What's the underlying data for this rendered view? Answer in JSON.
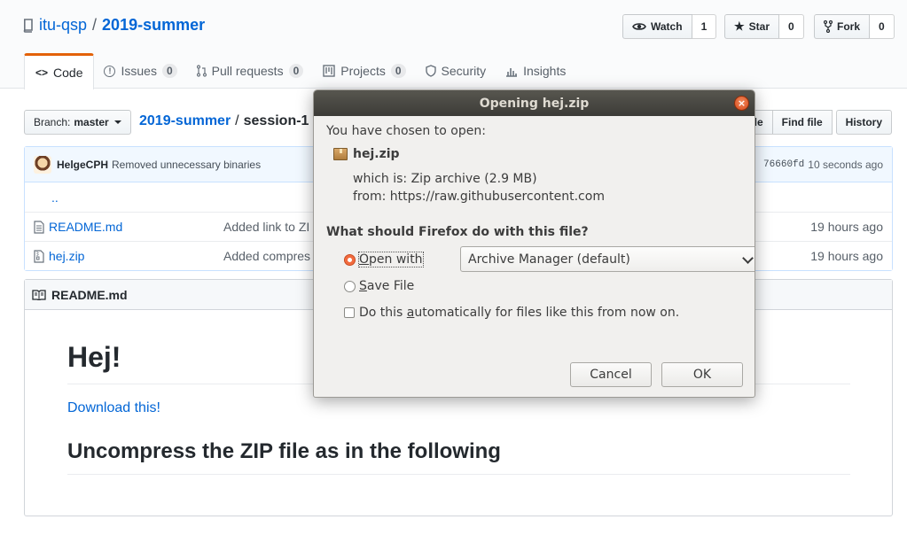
{
  "repo": {
    "owner": "itu-qsp",
    "separator": "/",
    "name": "2019-summer"
  },
  "actions": [
    {
      "label": "Watch",
      "count": "1"
    },
    {
      "label": "Star",
      "count": "0"
    },
    {
      "label": "Fork",
      "count": "0"
    }
  ],
  "tabs": [
    {
      "label": "Code"
    },
    {
      "label": "Issues",
      "count": "0"
    },
    {
      "label": "Pull requests",
      "count": "0"
    },
    {
      "label": "Projects",
      "count": "0"
    },
    {
      "label": "Security"
    },
    {
      "label": "Insights"
    }
  ],
  "branch": {
    "prefix": "Branch:",
    "name": "master"
  },
  "breadcrumb": {
    "root": "2019-summer",
    "sep": "/",
    "current": "session-1",
    "sep2": "/"
  },
  "file_buttons": {
    "create": "ile",
    "find": "Find file",
    "history": "History"
  },
  "commit": {
    "author": "HelgeCPH",
    "message": "Removed unnecessary binaries",
    "sha": "76660fd",
    "age": "10 seconds ago"
  },
  "files": [
    {
      "name": "..",
      "message": "",
      "age": ""
    },
    {
      "name": "README.md",
      "message": "Added link to ZI",
      "age": "19 hours ago"
    },
    {
      "name": "hej.zip",
      "message": "Added compres",
      "age": "19 hours ago"
    }
  ],
  "readme": {
    "header": "README.md",
    "h1": "Hej!",
    "link": "Download this!",
    "h2": "Uncompress the ZIP file as in the following"
  },
  "dialog": {
    "title": "Opening hej.zip",
    "close": "×",
    "chosen": "You have chosen to open:",
    "filename": "hej.zip",
    "which_label": "which is:",
    "which_value": "Zip archive (2.9 MB)",
    "from_label": "from:",
    "from_value": "https://raw.githubusercontent.com",
    "question": "What should Firefox do with this file?",
    "open_with_u": "O",
    "open_with_rest": "pen with",
    "app": "Archive Manager (default)",
    "save_u": "S",
    "save_rest": "ave File",
    "auto_pre": "Do this ",
    "auto_u": "a",
    "auto_post": "utomatically for files like this from now on.",
    "cancel": "Cancel",
    "ok": "OK"
  },
  "colors": {
    "link": "#0366d6",
    "tab_accent": "#e36209",
    "titlebar": "#3c3b37",
    "radio_on": "#ef5d2d"
  }
}
